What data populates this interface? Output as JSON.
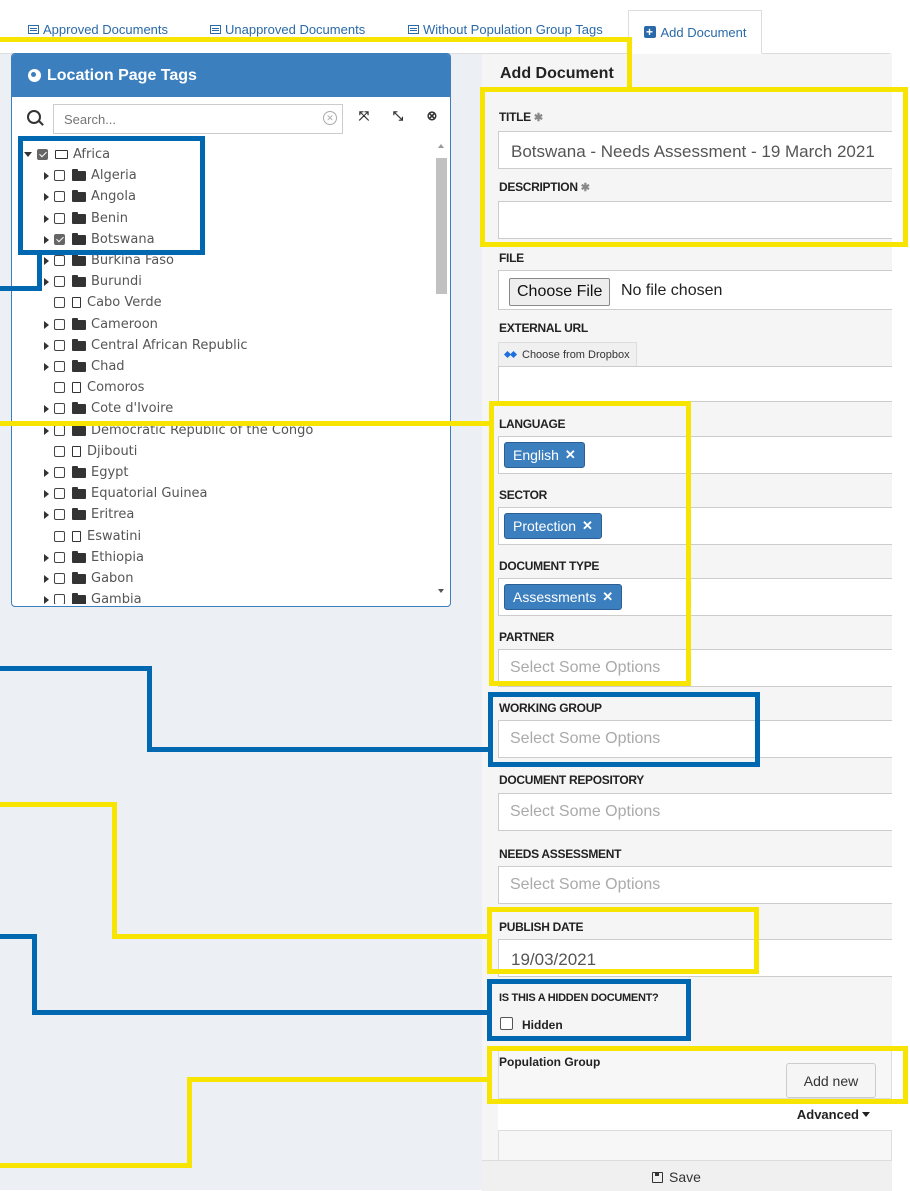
{
  "tabs": [
    {
      "label": "Approved Documents",
      "icon": "list-icon"
    },
    {
      "label": "Unapproved Documents",
      "icon": "list-icon"
    },
    {
      "label": "Without Population Group Tags",
      "icon": "list-icon"
    },
    {
      "label": "Add Document",
      "icon": "plus-square-icon",
      "active": true
    }
  ],
  "location_panel": {
    "title": "Location Page Tags",
    "search_placeholder": "Search...",
    "tree": [
      {
        "label": "Africa",
        "type": "folder-open",
        "expanded": true,
        "checked": true,
        "level": 0
      },
      {
        "label": "Algeria",
        "type": "folder",
        "checked": false,
        "level": 1
      },
      {
        "label": "Angola",
        "type": "folder",
        "checked": false,
        "level": 1
      },
      {
        "label": "Benin",
        "type": "folder",
        "checked": false,
        "level": 1
      },
      {
        "label": "Botswana",
        "type": "folder",
        "checked": true,
        "level": 1
      },
      {
        "label": "Burkina Faso",
        "type": "folder",
        "checked": false,
        "level": 1
      },
      {
        "label": "Burundi",
        "type": "folder",
        "checked": false,
        "level": 1
      },
      {
        "label": "Cabo Verde",
        "type": "file",
        "checked": false,
        "level": 1
      },
      {
        "label": "Cameroon",
        "type": "folder",
        "checked": false,
        "level": 1
      },
      {
        "label": "Central African Republic",
        "type": "folder",
        "checked": false,
        "level": 1
      },
      {
        "label": "Chad",
        "type": "folder",
        "checked": false,
        "level": 1
      },
      {
        "label": "Comoros",
        "type": "file",
        "checked": false,
        "level": 1
      },
      {
        "label": "Cote d'Ivoire",
        "type": "folder",
        "checked": false,
        "level": 1
      },
      {
        "label": "Democratic Republic of the Congo",
        "type": "folder",
        "checked": false,
        "level": 1
      },
      {
        "label": "Djibouti",
        "type": "file",
        "checked": false,
        "level": 1
      },
      {
        "label": "Egypt",
        "type": "folder",
        "checked": false,
        "level": 1
      },
      {
        "label": "Equatorial Guinea",
        "type": "folder",
        "checked": false,
        "level": 1
      },
      {
        "label": "Eritrea",
        "type": "folder",
        "checked": false,
        "level": 1
      },
      {
        "label": "Eswatini",
        "type": "file",
        "checked": false,
        "level": 1
      },
      {
        "label": "Ethiopia",
        "type": "folder",
        "checked": false,
        "level": 1
      },
      {
        "label": "Gabon",
        "type": "folder",
        "checked": false,
        "level": 1
      },
      {
        "label": "Gambia",
        "type": "folder",
        "checked": false,
        "level": 1
      }
    ]
  },
  "form": {
    "heading": "Add Document",
    "title_label": "TITLE",
    "title_value": "Botswana - Needs Assessment - 19 March 2021",
    "required_mark": "✱",
    "description_label": "DESCRIPTION",
    "description_value": "",
    "file_label": "FILE",
    "choose_file": "Choose File",
    "no_file": "No file chosen",
    "external_url_label": "EXTERNAL URL",
    "dropbox_button": "Choose from Dropbox",
    "language_label": "LANGUAGE",
    "language_tag": "English",
    "sector_label": "SECTOR",
    "sector_tag": "Protection",
    "document_type_label": "DOCUMENT TYPE",
    "document_type_tag": "Assessments",
    "partner_label": "PARTNER",
    "working_group_label": "WORKING GROUP",
    "document_repository_label": "DOCUMENT REPOSITORY",
    "needs_assessment_label": "NEEDS ASSESSMENT",
    "select_placeholder": "Select Some Options",
    "publish_date_label": "PUBLISH DATE",
    "publish_date_value": "19/03/2021",
    "hidden_question_label": "IS THIS A HIDDEN DOCUMENT?",
    "hidden_checkbox_label": "Hidden",
    "hidden_checked": false,
    "population_group_label": "Population Group",
    "add_new_button": "Add new",
    "advanced_label": "Advanced",
    "save_button": "Save",
    "tag_remove": "✕"
  },
  "colors": {
    "highlight_yellow": "#f7e400",
    "highlight_blue": "#0067b1",
    "panel_blue": "#3c7fbf",
    "link_blue": "#2a6aa8"
  }
}
